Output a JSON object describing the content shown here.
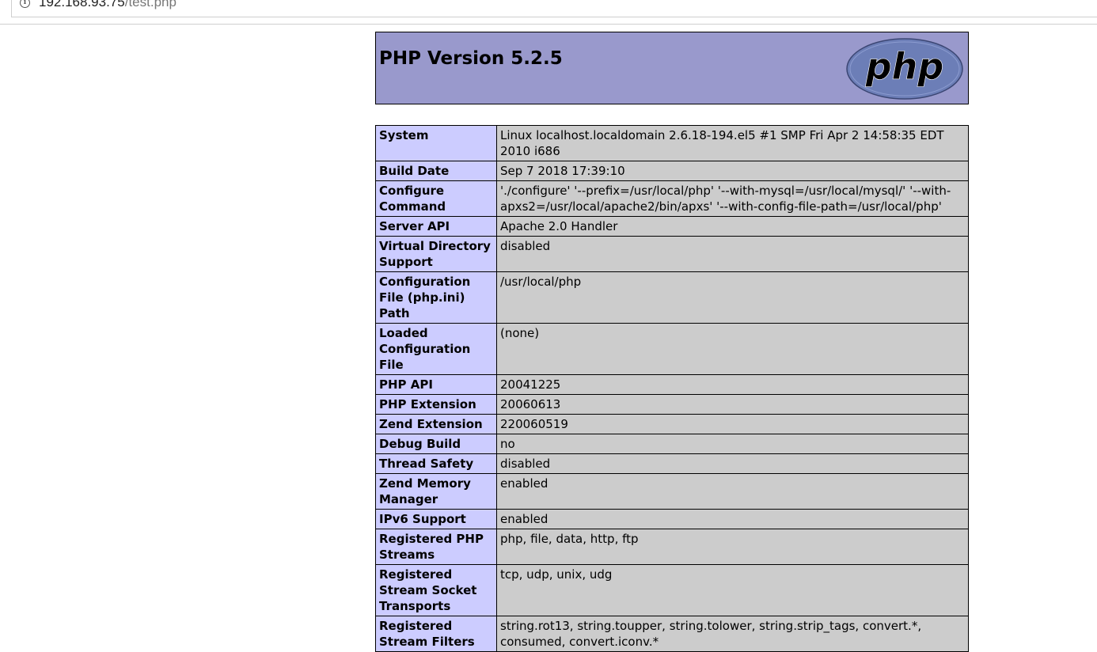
{
  "browser": {
    "url_host": "192.168.93.75",
    "url_path": "/test.php",
    "info_icon": "info-circle-icon"
  },
  "header": {
    "title": "PHP Version 5.2.5",
    "logo_text": "php",
    "logo_colors": {
      "fill": "#6c7eb7",
      "ink": "#000000"
    }
  },
  "rows": [
    {
      "key": "System",
      "value": "Linux localhost.localdomain 2.6.18-194.el5 #1 SMP Fri Apr 2 14:58:35 EDT 2010 i686"
    },
    {
      "key": "Build Date",
      "value": "Sep 7 2018 17:39:10"
    },
    {
      "key": "Configure Command",
      "value": "'./configure' '--prefix=/usr/local/php' '--with-mysql=/usr/local/mysql/' '--with-apxs2=/usr/local/apache2/bin/apxs' '--with-config-file-path=/usr/local/php'"
    },
    {
      "key": "Server API",
      "value": "Apache 2.0 Handler"
    },
    {
      "key": "Virtual Directory Support",
      "value": "disabled"
    },
    {
      "key": "Configuration File (php.ini) Path",
      "value": "/usr/local/php"
    },
    {
      "key": "Loaded Configuration File",
      "value": "(none)"
    },
    {
      "key": "PHP API",
      "value": "20041225"
    },
    {
      "key": "PHP Extension",
      "value": "20060613"
    },
    {
      "key": "Zend Extension",
      "value": "220060519"
    },
    {
      "key": "Debug Build",
      "value": "no"
    },
    {
      "key": "Thread Safety",
      "value": "disabled"
    },
    {
      "key": "Zend Memory Manager",
      "value": "enabled"
    },
    {
      "key": "IPv6 Support",
      "value": "enabled"
    },
    {
      "key": "Registered PHP Streams",
      "value": "php, file, data, http, ftp"
    },
    {
      "key": "Registered Stream Socket Transports",
      "value": "tcp, udp, unix, udg"
    },
    {
      "key": "Registered Stream Filters",
      "value": "string.rot13, string.toupper, string.tolower, string.strip_tags, convert.*, consumed, convert.iconv.*"
    }
  ],
  "colors": {
    "header_bg": "#9999cc",
    "key_bg": "#ccccff",
    "value_bg": "#cccccc"
  }
}
